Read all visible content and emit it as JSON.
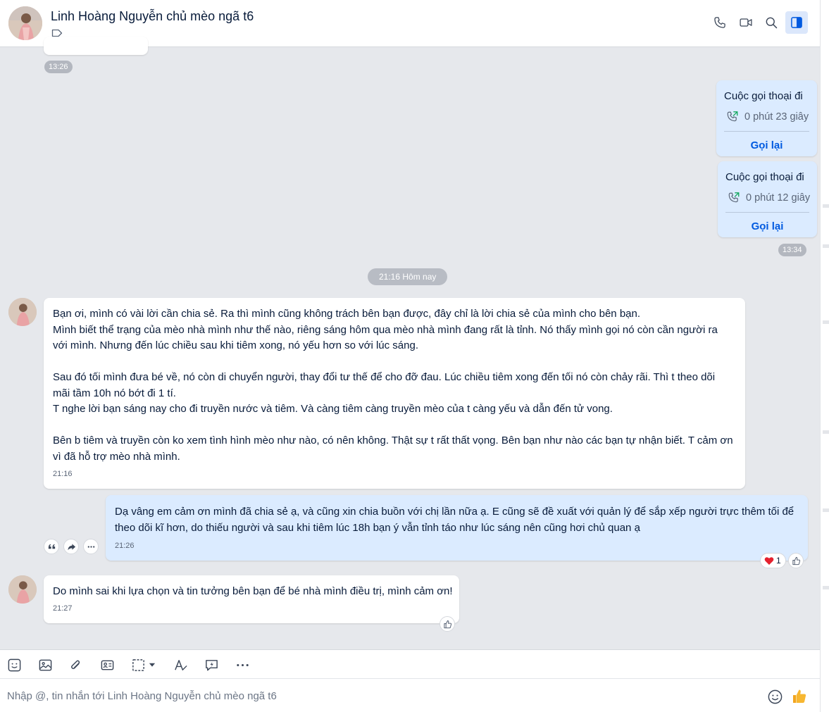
{
  "header": {
    "contact_name": "Linh Hoàng Nguyễn chủ mèo ngã t6"
  },
  "messages": {
    "early_time": "13:26",
    "calls": [
      {
        "title": "Cuộc gọi thoại đi",
        "duration": "0 phút 23 giây",
        "action": "Gọi lại"
      },
      {
        "title": "Cuộc gọi thoại đi",
        "duration": "0 phút 12 giây",
        "action": "Gọi lại"
      }
    ],
    "calls_time": "13:34",
    "date_divider": "21:16 Hôm nay",
    "incoming_1": {
      "text": "Bạn ơi, mình có vài lời cần chia sẻ. Ra thì mình cũng không trách bên bạn được, đây chỉ là lời chia sẻ của mình cho bên bạn.\nMình biết thể trạng của mèo nhà mình như thế nào, riêng sáng hôm qua mèo nhà mình đang rất là tỉnh. Nó thấy mình gọi nó còn cần người ra với mình. Nhưng đến lúc chiều sau khi tiêm xong, nó yếu hơn so với lúc sáng.\n\nSau đó tối mình đưa bé về, nó còn di chuyển người, thay đổi tư thế để cho đỡ đau. Lúc chiều tiêm xong đến tối nó còn chảy rãi. Thì t theo dõi mãi tầm 10h nó bớt đi 1 tí.\nT nghe lời bạn sáng nay cho đi truyền nước và tiêm. Và càng tiêm càng truyền mèo của t càng yếu và dẫn đến tử vong.\n\nBên b tiêm và truyền còn ko xem tình hình mèo như nào, có nên không. Thật sự t rất thất vọng. Bên bạn như nào các bạn tự nhận biết. T cảm ơn vì đã hỗ trợ mèo nhà mình.",
      "time": "21:16"
    },
    "outgoing_1": {
      "text": "Dạ vâng em cảm ơn mình đã chia sẻ ạ, và cũng xin chia buồn với chị lần nữa ạ. E cũng sẽ đề xuất với quản lý để sắp xếp người trực thêm tối để theo dõi kĩ hơn, do thiếu người và sau khi tiêm lúc 18h bạn ý vẫn tỉnh táo như lúc sáng nên cũng hơi chủ quan ạ",
      "time": "21:26",
      "heart_count": "1"
    },
    "incoming_2": {
      "text": "Do mình sai khi lựa chọn và tin tưởng bên bạn để bé nhà mình điều trị, mình cảm ơn!",
      "time": "21:27"
    }
  },
  "composer": {
    "placeholder": "Nhập @, tin nhắn tới Linh Hoàng Nguyễn chủ mèo ngã t6"
  },
  "colors": {
    "accent": "#005ae0",
    "outgoing_bubble": "#dbebff",
    "chat_background": "#e6e8ec"
  }
}
